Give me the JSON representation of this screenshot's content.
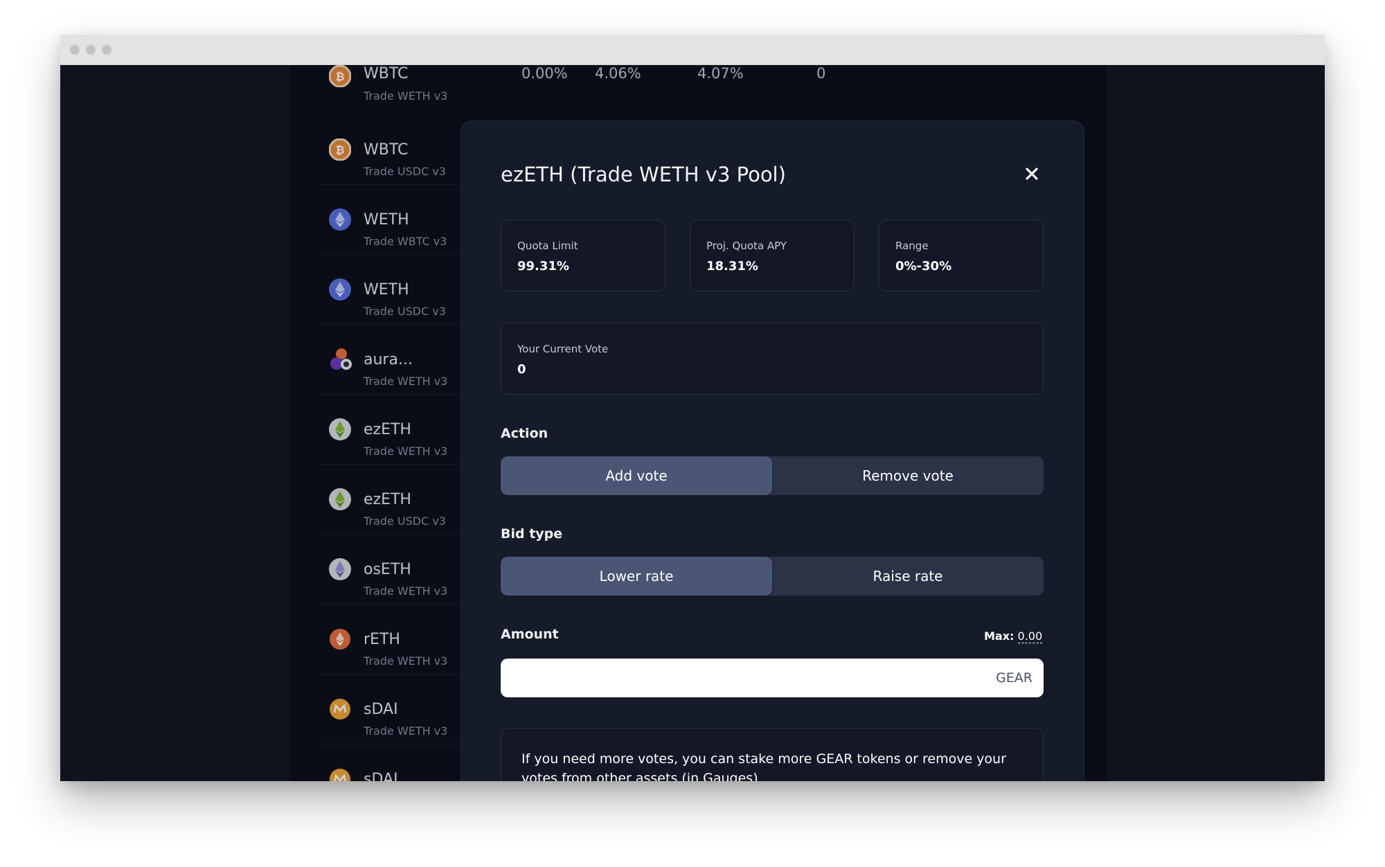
{
  "background_list": {
    "top_row": {
      "name": "WBTC",
      "sub": "Trade WETH v3",
      "col1": "0.00%",
      "col2": "4.06%",
      "col3": "4.07%",
      "col4": "0"
    },
    "rows": [
      {
        "name": "WBTC",
        "sub": "Trade USDC v3",
        "icon": "bitcoin-icon"
      },
      {
        "name": "WETH",
        "sub": "Trade WBTC v3",
        "icon": "ethereum-icon"
      },
      {
        "name": "WETH",
        "sub": "Trade USDC v3",
        "icon": "ethereum-icon"
      },
      {
        "name": "aura...",
        "sub": "Trade WETH v3",
        "icon": "aura-lp-icon"
      },
      {
        "name": "ezETH",
        "sub": "Trade WETH v3",
        "icon": "ezeth-icon"
      },
      {
        "name": "ezETH",
        "sub": "Trade USDC v3",
        "icon": "ezeth-icon"
      },
      {
        "name": "osETH",
        "sub": "Trade WETH v3",
        "icon": "oseth-icon"
      },
      {
        "name": "rETH",
        "sub": "Trade WETH v3",
        "icon": "reth-icon"
      },
      {
        "name": "sDAI",
        "sub": "Trade WETH v3",
        "icon": "sdai-icon"
      },
      {
        "name": "sDAI",
        "sub": "",
        "icon": "sdai-icon"
      }
    ]
  },
  "modal": {
    "title": "ezETH (Trade WETH v3 Pool)",
    "stats": [
      {
        "label": "Quota Limit",
        "value": "99.31%"
      },
      {
        "label": "Proj. Quota APY",
        "value": "18.31%"
      },
      {
        "label": "Range",
        "value": "0%-30%"
      }
    ],
    "current_vote": {
      "label": "Your Current Vote",
      "value": "0"
    },
    "action": {
      "label": "Action",
      "options": [
        "Add vote",
        "Remove vote"
      ],
      "selected": "Add vote"
    },
    "bid_type": {
      "label": "Bid type",
      "options": [
        "Lower rate",
        "Raise rate"
      ],
      "selected": "Lower rate"
    },
    "amount": {
      "label": "Amount",
      "max_label": "Max:",
      "max_value": "0.00",
      "value": "",
      "unit": "GEAR"
    },
    "info": "If you need more votes, you can stake more GEAR tokens or remove your votes from other assets (in Gauges)"
  },
  "colors": {
    "page_bg": "#111522",
    "modal_bg": "#161b29",
    "toggle_bg": "#2c3347",
    "toggle_active": "#4b5675",
    "bitcoin": "#e6893a",
    "ethereum": "#5a6fe0",
    "ezeth": "#7dbb32",
    "oseth": "#9c8fd8",
    "reth": "#e8703a",
    "sdai": "#f1a53a"
  }
}
